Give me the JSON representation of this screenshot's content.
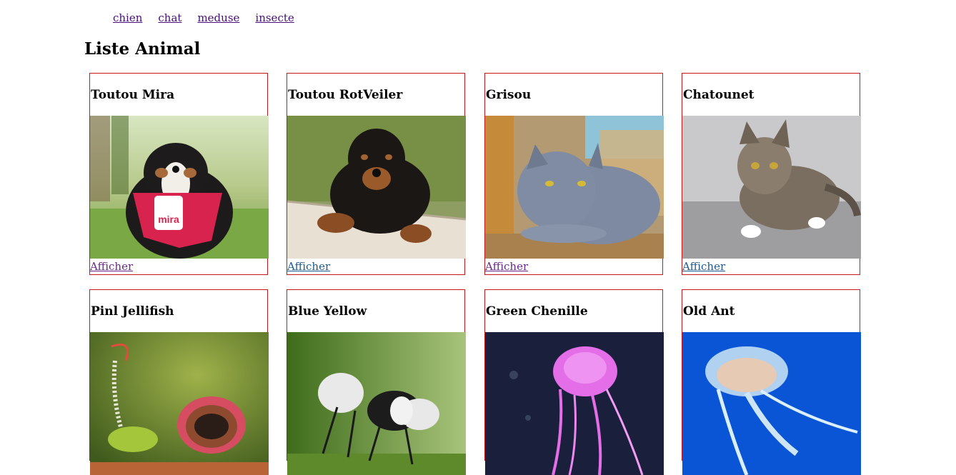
{
  "nav": {
    "items": [
      {
        "label": "chien"
      },
      {
        "label": "chat"
      },
      {
        "label": "meduse"
      },
      {
        "label": "insecte"
      }
    ]
  },
  "page": {
    "title": "Liste Animal"
  },
  "cards": [
    {
      "name": "Toutou Mira",
      "link": "Afficher",
      "image": "bernese-puppy-with-mira-bandana"
    },
    {
      "name": "Toutou RotVeiler",
      "link": "Afficher",
      "image": "rottweiler-puppy-on-wooden-plank"
    },
    {
      "name": "Grisou",
      "link": "Afficher",
      "image": "grey-british-shorthair-cat"
    },
    {
      "name": "Chatounet",
      "link": "Afficher",
      "image": "tabby-kitten"
    },
    {
      "name": "Pinl Jellifish",
      "image": "green-caterpillar"
    },
    {
      "name": "Blue Yellow",
      "image": "black-white-velvet-ant"
    },
    {
      "name": "Green Chenille",
      "image": "pink-jellyfish"
    },
    {
      "name": "Old Ant",
      "image": "blue-jellyfish"
    }
  ],
  "colors": {
    "card_border": "#c61a1a",
    "link_visited": "#6a2a88",
    "link": "#1f5a8e"
  }
}
